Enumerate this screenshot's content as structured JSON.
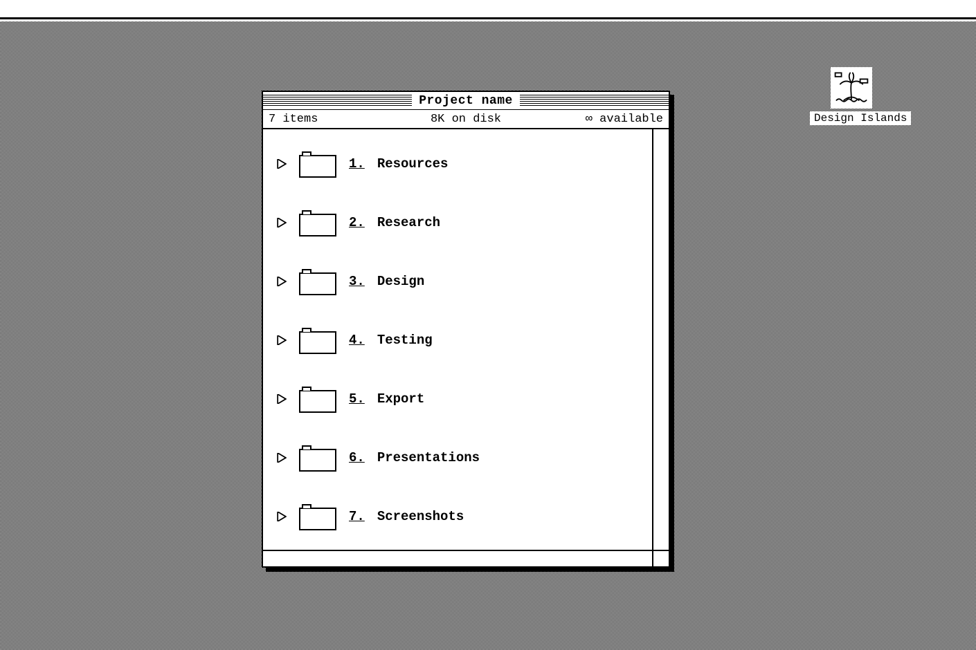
{
  "desktop": {
    "disk_label": "Design Islands"
  },
  "window": {
    "title": "Project name",
    "info": {
      "items": "7 items",
      "disk": "8K on disk",
      "available": "∞ available"
    },
    "folders": [
      {
        "num": "1.",
        "name": "Resources"
      },
      {
        "num": "2.",
        "name": "Research"
      },
      {
        "num": "3.",
        "name": "Design"
      },
      {
        "num": "4.",
        "name": "Testing"
      },
      {
        "num": "5.",
        "name": "Export"
      },
      {
        "num": "6.",
        "name": "Presentations"
      },
      {
        "num": "7.",
        "name": "Screenshots"
      }
    ]
  }
}
